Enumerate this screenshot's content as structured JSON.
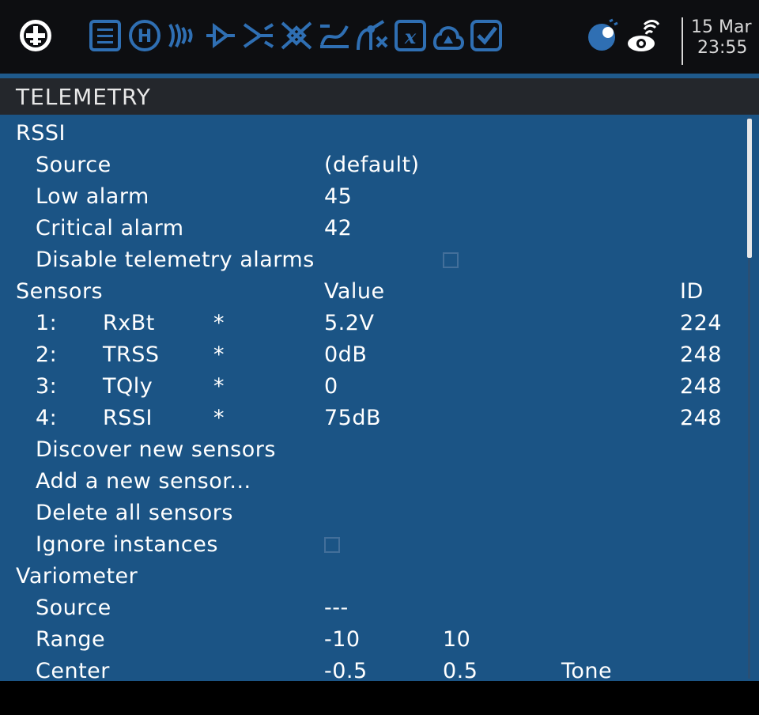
{
  "topbar": {
    "icons": [
      "model-select-icon",
      "model-setup-icon",
      "heli-icon",
      "flight-modes-icon",
      "inputs-icon",
      "mixes-icon",
      "outputs-icon",
      "curves-icon",
      "gvars-icon",
      "logical-switches-icon",
      "special-functions-icon",
      "checklist-icon",
      "timers-icon",
      "telemetry-icon"
    ],
    "date": "15 Mar",
    "time": "23:55"
  },
  "title": "TELEMETRY",
  "rssi": {
    "header": "RSSI",
    "source_label": "Source",
    "source_value": "(default)",
    "low_label": "Low alarm",
    "low_value": "45",
    "critical_label": "Critical alarm",
    "critical_value": "42",
    "disable_label": "Disable telemetry alarms",
    "disable_checked": false
  },
  "sensors": {
    "header": "Sensors",
    "value_header": "Value",
    "id_header": "ID",
    "items": [
      {
        "num": "1:",
        "name": "RxBt",
        "star": "*",
        "value": "5.2V",
        "id": "224"
      },
      {
        "num": "2:",
        "name": "TRSS",
        "star": "*",
        "value": "0dB",
        "id": "248"
      },
      {
        "num": "3:",
        "name": "TQly",
        "star": "*",
        "value": "0",
        "id": "248"
      },
      {
        "num": "4:",
        "name": "RSSI",
        "star": "*",
        "value": "75dB",
        "id": "248"
      }
    ],
    "discover_label": "Discover new sensors",
    "add_label": "Add a new sensor...",
    "delete_label": "Delete all sensors",
    "ignore_label": "Ignore instances",
    "ignore_checked": false
  },
  "vario": {
    "header": "Variometer",
    "source_label": "Source",
    "source_value": "---",
    "range_label": "Range",
    "range_min": "-10",
    "range_max": "10",
    "center_label": "Center",
    "center_min": "-0.5",
    "center_max": "0.5",
    "center_mode": "Tone"
  },
  "colors": {
    "background": "#1b5485",
    "titlebar": "#24272c",
    "topbar": "#0d0e11",
    "text": "#ffffff",
    "icon_blue": "#2f6fb3"
  }
}
